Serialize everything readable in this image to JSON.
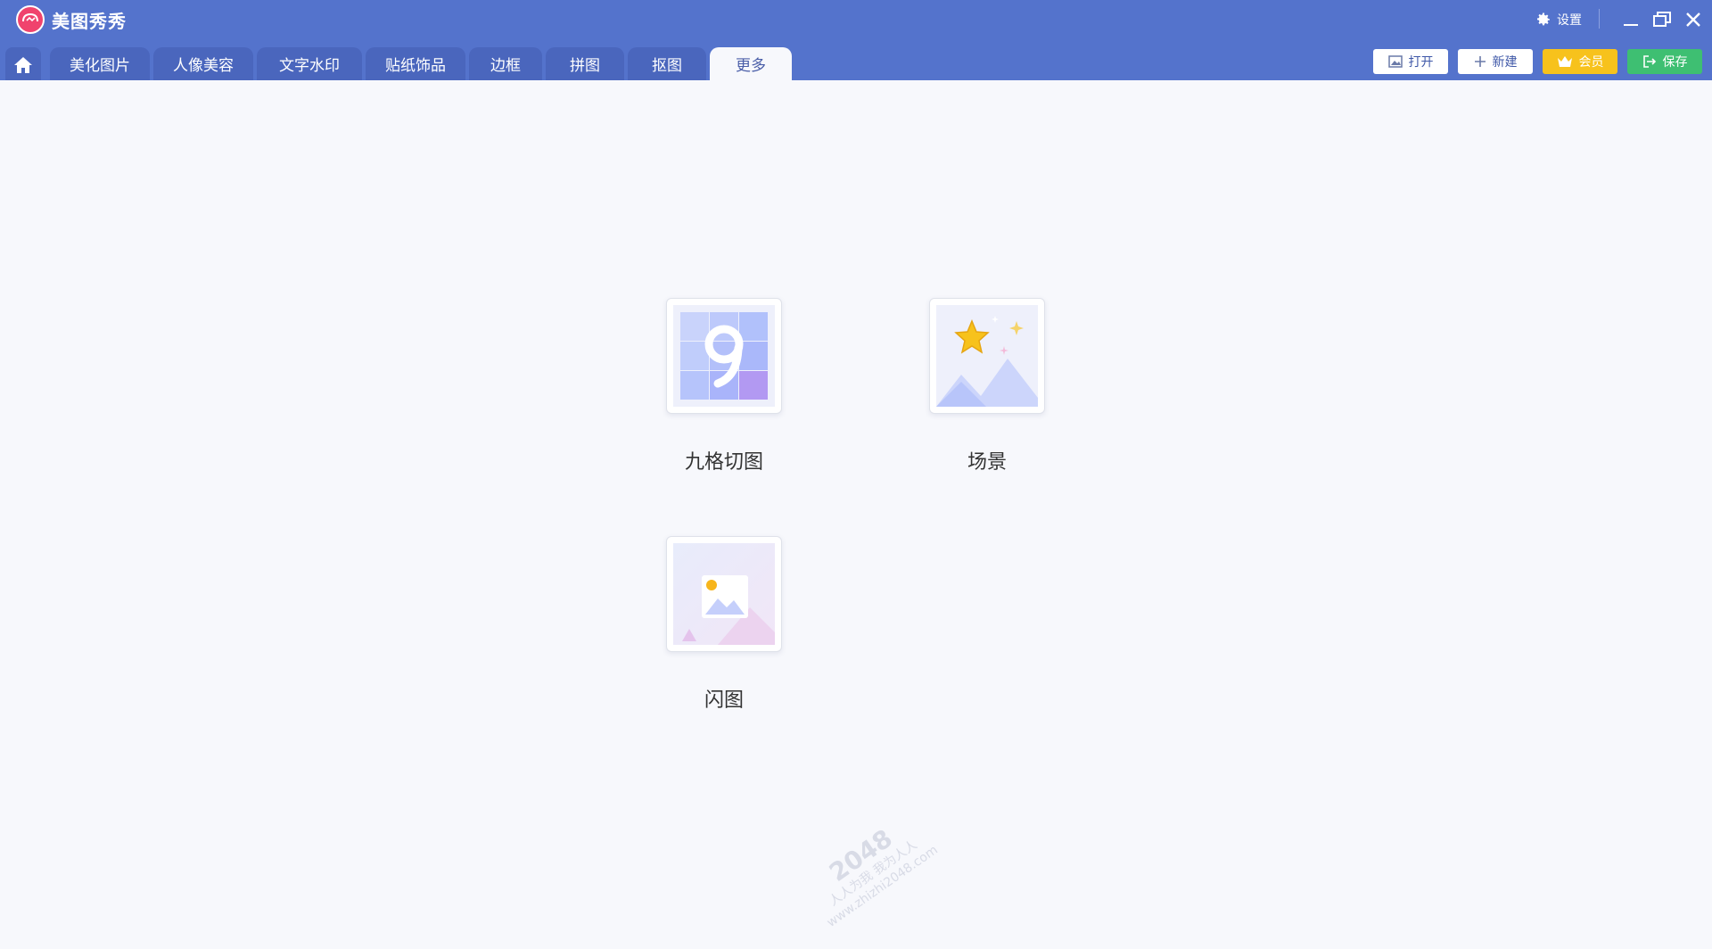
{
  "app": {
    "title": "美图秀秀"
  },
  "window": {
    "settings_label": "设置"
  },
  "tabs": [
    {
      "label": "美化图片"
    },
    {
      "label": "人像美容"
    },
    {
      "label": "文字水印"
    },
    {
      "label": "贴纸饰品"
    },
    {
      "label": "边框"
    },
    {
      "label": "拼图"
    },
    {
      "label": "抠图"
    },
    {
      "label": "更多",
      "active": true
    }
  ],
  "toolbar": {
    "open_label": "打开",
    "new_label": "新建",
    "vip_label": "会员",
    "save_label": "保存"
  },
  "tools": [
    {
      "label": "九格切图",
      "icon": "nine-grid-icon"
    },
    {
      "label": "场景",
      "icon": "scene-icon"
    },
    {
      "label": "闪图",
      "icon": "flash-image-icon"
    }
  ],
  "watermark": {
    "line1": "2048",
    "line2": "人人为我 我为人人",
    "line3": "www.zhizhi2048.com"
  },
  "colors": {
    "titlebar": "#5473cc",
    "tab": "#4a66bd",
    "background": "#f7f8fc",
    "vip": "#f7c21c",
    "save": "#3ebf72",
    "logo": "#f0436d"
  }
}
